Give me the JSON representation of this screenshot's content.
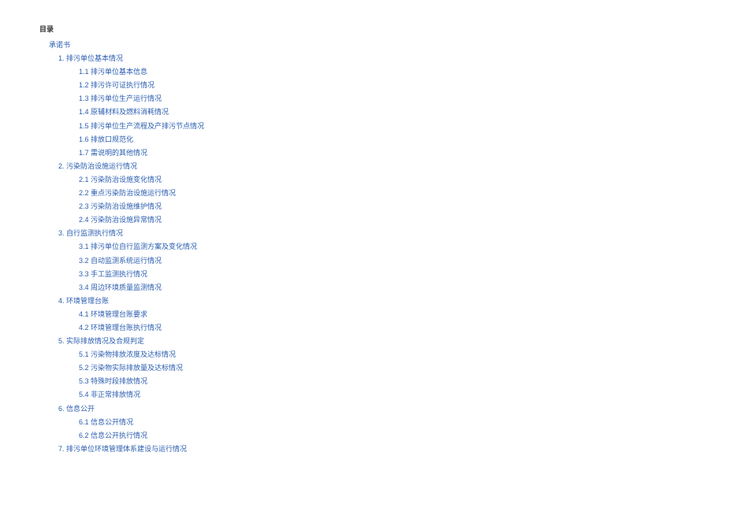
{
  "title": "目录",
  "items": [
    {
      "level": 0,
      "text": "承诺书"
    },
    {
      "level": 1,
      "text": "1. 排污单位基本情况"
    },
    {
      "level": 2,
      "text": "1.1 排污单位基本信息"
    },
    {
      "level": 2,
      "text": "1.2 排污许可证执行情况"
    },
    {
      "level": 2,
      "text": "1.3 排污单位生产运行情况"
    },
    {
      "level": 2,
      "text": "1.4 原辅材料及燃料消耗情况"
    },
    {
      "level": 2,
      "text": "1.5 排污单位生产流程及产排污节点情况"
    },
    {
      "level": 2,
      "text": "1.6 排放口规范化"
    },
    {
      "level": 2,
      "text": "1.7 需说明的其他情况"
    },
    {
      "level": 1,
      "text": "2. 污染防治设施运行情况"
    },
    {
      "level": 2,
      "text": "2.1 污染防治设施变化情况"
    },
    {
      "level": 2,
      "text": "2.2 重点污染防治设施运行情况"
    },
    {
      "level": 2,
      "text": "2.3 污染防治设施维护情况"
    },
    {
      "level": 2,
      "text": "2.4 污染防治设施异常情况"
    },
    {
      "level": 1,
      "text": "3. 自行监测执行情况"
    },
    {
      "level": 2,
      "text": "3.1 排污单位自行监测方案及变化情况"
    },
    {
      "level": 2,
      "text": "3.2 自动监测系统运行情况"
    },
    {
      "level": 2,
      "text": "3.3 手工监测执行情况"
    },
    {
      "level": 2,
      "text": "3.4 周边环境质量监测情况"
    },
    {
      "level": 1,
      "text": "4. 环境管理台账"
    },
    {
      "level": 2,
      "text": "4.1 环境管理台账要求"
    },
    {
      "level": 2,
      "text": "4.2 环境管理台账执行情况"
    },
    {
      "level": 1,
      "text": "5. 实际排放情况及合规判定"
    },
    {
      "level": 2,
      "text": "5.1 污染物排放浓度及达标情况"
    },
    {
      "level": 2,
      "text": "5.2 污染物实际排放量及达标情况"
    },
    {
      "level": 2,
      "text": "5.3 特殊时段排放情况"
    },
    {
      "level": 2,
      "text": "5.4 非正常排放情况"
    },
    {
      "level": 1,
      "text": "6. 信息公开"
    },
    {
      "level": 2,
      "text": "6.1 信息公开情况"
    },
    {
      "level": 2,
      "text": "6.2 信息公开执行情况"
    },
    {
      "level": 1,
      "text": "7. 排污单位环境管理体系建设与运行情况"
    }
  ]
}
